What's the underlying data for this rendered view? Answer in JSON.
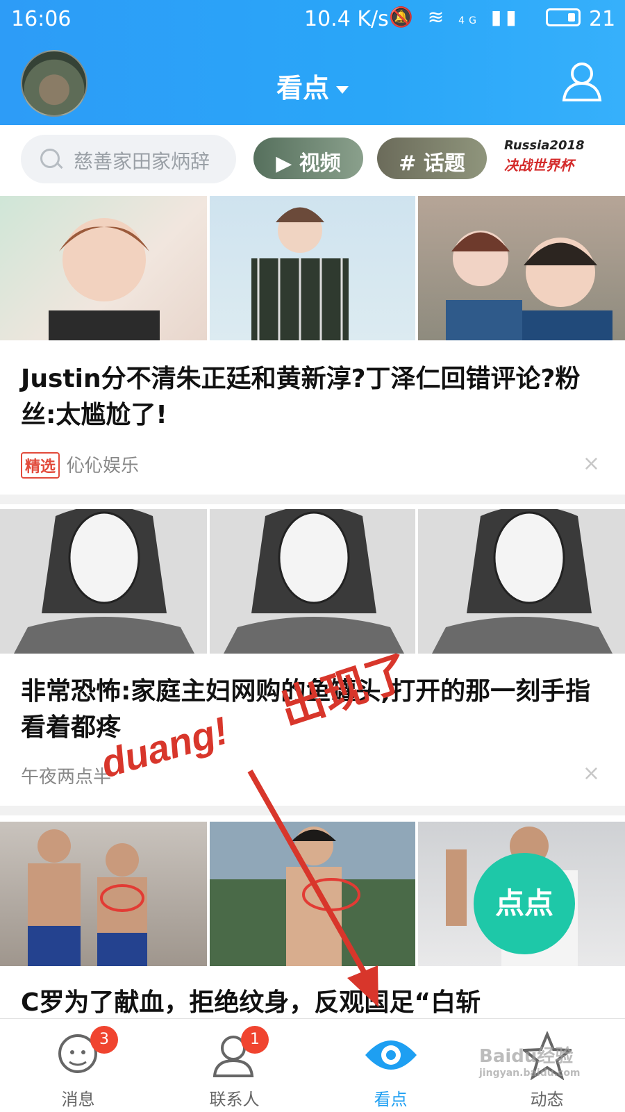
{
  "status": {
    "time": "16:06",
    "speed": "10.4 K/s",
    "net": "4G",
    "battery": "21"
  },
  "header": {
    "title": "看点"
  },
  "search": {
    "placeholder": "慈善家田家炳辞"
  },
  "chips": [
    {
      "label": "视频"
    },
    {
      "label": "话题"
    }
  ],
  "promo": {
    "line1": "Russia2018",
    "line2": "决战世界杯"
  },
  "articles": [
    {
      "headline": "Justin分不清朱正廷和黄新淳?丁泽仁回错评论?粉丝:太尴尬了!",
      "tag": "精选",
      "source": "伈伈娱乐",
      "close": "×"
    },
    {
      "headline": "非常恐怖:家庭主妇网购的鱼罐头,打开的那一刻手指看着都疼",
      "source": "午夜两点半",
      "close": "×"
    },
    {
      "headline": "C罗为了献血，拒绝纹身，反观国足“白斩",
      "floating": "点点"
    }
  ],
  "annotation": {
    "text1": "duang!",
    "text2": "出现了"
  },
  "tabs": [
    {
      "label": "消息",
      "badge": "3"
    },
    {
      "label": "联系人",
      "badge": "1"
    },
    {
      "label": "看点"
    },
    {
      "label": "动态"
    }
  ],
  "watermark": {
    "brand": "Baidu经验",
    "url": "jingyan.baidu.com"
  }
}
